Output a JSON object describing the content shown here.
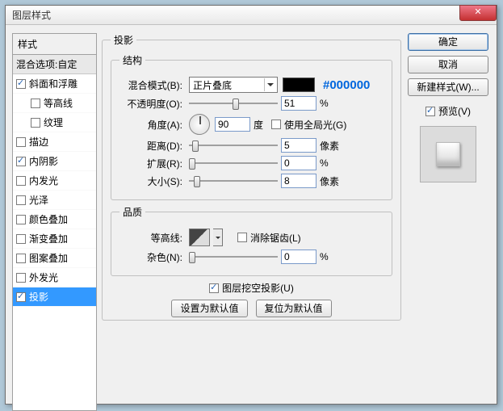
{
  "window": {
    "title": "图层样式"
  },
  "left": {
    "header": "样式",
    "blend": "混合选项:自定",
    "items": [
      {
        "label": "斜面和浮雕",
        "checked": true,
        "indent": false,
        "selected": false
      },
      {
        "label": "等高线",
        "checked": false,
        "indent": true,
        "selected": false
      },
      {
        "label": "纹理",
        "checked": false,
        "indent": true,
        "selected": false
      },
      {
        "label": "描边",
        "checked": false,
        "indent": false,
        "selected": false
      },
      {
        "label": "内阴影",
        "checked": true,
        "indent": false,
        "selected": false
      },
      {
        "label": "内发光",
        "checked": false,
        "indent": false,
        "selected": false
      },
      {
        "label": "光泽",
        "checked": false,
        "indent": false,
        "selected": false
      },
      {
        "label": "颜色叠加",
        "checked": false,
        "indent": false,
        "selected": false
      },
      {
        "label": "渐变叠加",
        "checked": false,
        "indent": false,
        "selected": false
      },
      {
        "label": "图案叠加",
        "checked": false,
        "indent": false,
        "selected": false
      },
      {
        "label": "外发光",
        "checked": false,
        "indent": false,
        "selected": false
      },
      {
        "label": "投影",
        "checked": true,
        "indent": false,
        "selected": true
      }
    ]
  },
  "panel": {
    "title": "投影",
    "structure": {
      "legend": "结构",
      "blendmode_label": "混合模式(B):",
      "blendmode_value": "正片叠底",
      "color_hex": "#000000",
      "opacity_label": "不透明度(O):",
      "opacity_value": "51",
      "pct": "%",
      "angle_label": "角度(A):",
      "angle_value": "90",
      "angle_unit": "度",
      "global_label": "使用全局光(G)",
      "distance_label": "距离(D):",
      "distance_value": "5",
      "px": "像素",
      "spread_label": "扩展(R):",
      "spread_value": "0",
      "size_label": "大小(S):",
      "size_value": "8"
    },
    "quality": {
      "legend": "品质",
      "contour_label": "等高线:",
      "antialias_label": "消除锯齿(L)",
      "noise_label": "杂色(N):",
      "noise_value": "0",
      "pct": "%"
    },
    "knockout_label": "图层挖空投影(U)",
    "btn_default": "设置为默认值",
    "btn_reset": "复位为默认值"
  },
  "right": {
    "ok": "确定",
    "cancel": "取消",
    "newstyle": "新建样式(W)...",
    "preview_label": "预览(V)"
  }
}
